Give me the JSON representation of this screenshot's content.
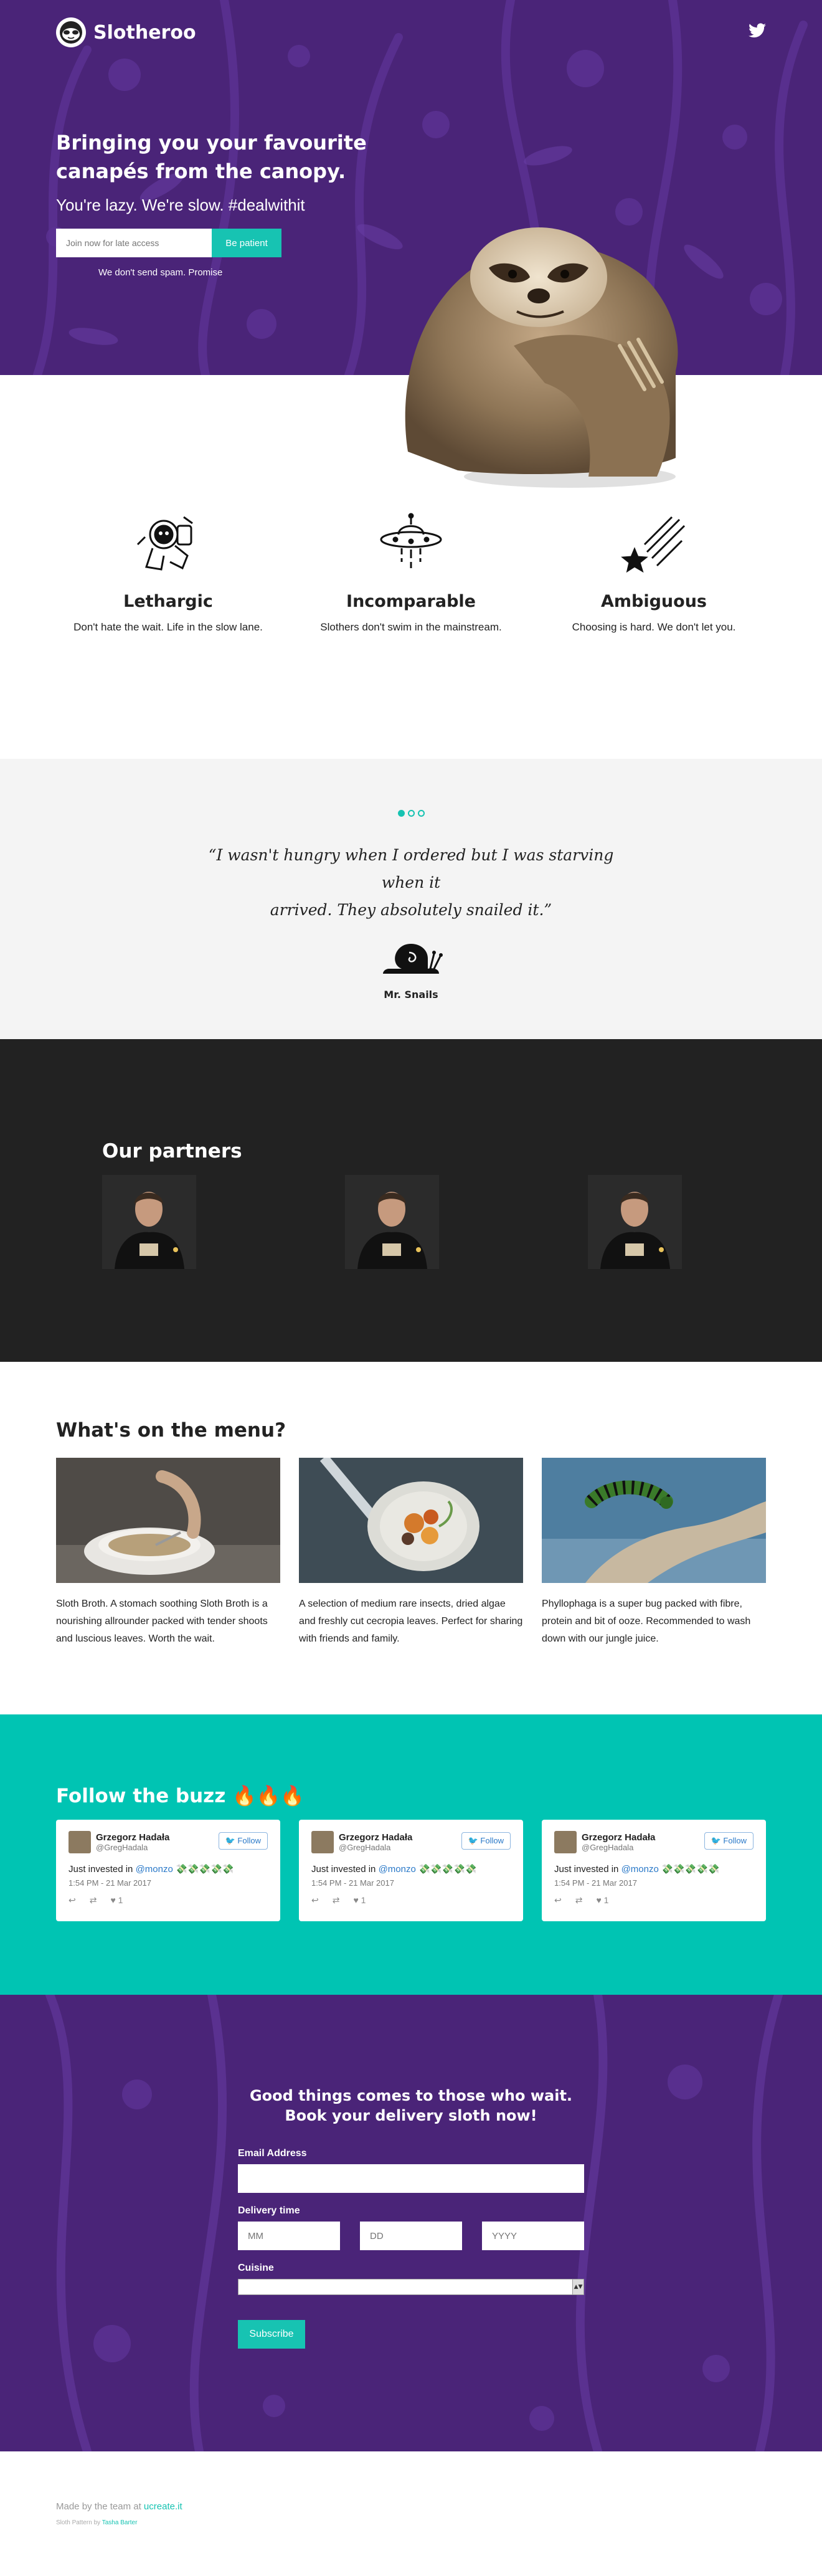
{
  "nav": {
    "brand": "Slotheroo",
    "twitter_icon": "twitter-icon"
  },
  "hero": {
    "headline_line1": "Bringing you your favourite",
    "headline_line2": "canapés from the canopy.",
    "subheadline": "You're lazy. We're slow. #dealwithit",
    "email_placeholder": "Join now for late access",
    "cta_label": "Be patient",
    "no_spam": "We don't send spam. Promise"
  },
  "features": [
    {
      "icon": "astronaut-sloth-icon",
      "title": "Lethargic",
      "desc": "Don't hate the wait. Life in the slow lane."
    },
    {
      "icon": "ufo-icon",
      "title": "Incomparable",
      "desc": "Slothers don't swim in the mainstream."
    },
    {
      "icon": "shooting-stars-icon",
      "title": "Ambiguous",
      "desc": "Choosing is hard. We don't let you."
    }
  ],
  "testimonial": {
    "quote_line1": "“I wasn't hungry when I ordered but I was starving when it",
    "quote_line2": "arrived. They absolutely snailed it.”",
    "author": "Mr. Snails"
  },
  "partners": {
    "title": "Our partners"
  },
  "menu": {
    "title": "What's on the menu?",
    "items": [
      {
        "desc": "Sloth Broth. A stomach soothing Sloth Broth is a nourishing allrounder packed with tender shoots and luscious leaves. Worth the wait."
      },
      {
        "desc": "A selection of medium rare insects, dried algae and freshly cut cecropia leaves. Perfect for sharing with friends and family."
      },
      {
        "desc": "Phyllophaga is a super bug packed with fibre, protein and bit of ooze. Recommended to wash down with our jungle juice."
      }
    ]
  },
  "buzz": {
    "title": "Follow the buzz 🔥🔥🔥",
    "tweets": [
      {
        "name": "Grzegorz Hadała",
        "handle": "@GregHadala",
        "follow": "Follow",
        "text_prefix": "Just invested in ",
        "mention": "@monzo",
        "emoji": "💸💸💸💸💸",
        "time": "1:54 PM - 21 Mar 2017",
        "likes": "1"
      },
      {
        "name": "Grzegorz Hadała",
        "handle": "@GregHadala",
        "follow": "Follow",
        "text_prefix": "Just invested in ",
        "mention": "@monzo",
        "emoji": "💸💸💸💸💸",
        "time": "1:54 PM - 21 Mar 2017",
        "likes": "1"
      },
      {
        "name": "Grzegorz Hadała",
        "handle": "@GregHadala",
        "follow": "Follow",
        "text_prefix": "Just invested in ",
        "mention": "@monzo",
        "emoji": "💸💸💸💸💸",
        "time": "1:54 PM - 21 Mar 2017",
        "likes": "1"
      }
    ]
  },
  "order": {
    "title_line1": "Good things comes to those who wait.",
    "title_line2": "Book your delivery sloth now!",
    "email_label": "Email Address",
    "delivery_label": "Delivery time",
    "mm_placeholder": "MM",
    "dd_placeholder": "DD",
    "yyyy_placeholder": "YYYY",
    "cuisine_label": "Cuisine",
    "cuisine_value": "",
    "subscribe_label": "Subscribe"
  },
  "footer": {
    "credit_prefix": "Made by the team at ",
    "credit_link": "ucreate.it",
    "small_prefix": "Sloth Pattern by ",
    "small_link": "Tasha Barter"
  },
  "colors": {
    "purple": "#4a2478",
    "teal": "#17c3b2",
    "dark": "#222222",
    "light_grey": "#f4f4f4"
  }
}
